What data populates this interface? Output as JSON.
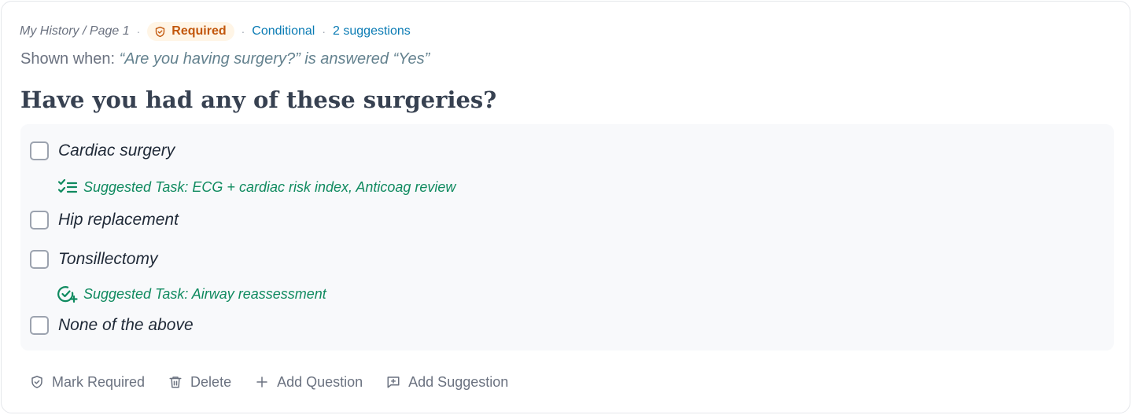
{
  "meta": {
    "breadcrumb": "My History / Page 1",
    "required_badge": "Required",
    "conditional_link": "Conditional",
    "suggestions_link": "2 suggestions"
  },
  "shown_when": {
    "prefix": "Shown when:",
    "condition": "“Are you having surgery?” is answered “Yes”"
  },
  "question": {
    "title": "Have you had any of these surgeries?"
  },
  "options": [
    {
      "label": "Cardiac surgery",
      "checked": false
    },
    {
      "label": "Hip replacement",
      "checked": false
    },
    {
      "label": "Tonsillectomy",
      "checked": false
    },
    {
      "label": "None of the above",
      "checked": false
    }
  ],
  "suggestions": [
    {
      "text": "Suggested Task:  ECG + cardiac risk index, Anticoag review",
      "icon": "checklist-icon"
    },
    {
      "text": "Suggested Task: Airway reassessment",
      "icon": "circle-check-plus-icon"
    }
  ],
  "actions": {
    "mark_required": "Mark Required",
    "delete": "Delete",
    "add_question": "Add Question",
    "add_suggestion": "Add Suggestion"
  },
  "colors": {
    "required_text": "#c2570c",
    "required_bg": "#fff5e6",
    "link": "#0a7bb4",
    "suggestion": "#0f8a5f",
    "panel_bg": "#f8f9fb"
  }
}
